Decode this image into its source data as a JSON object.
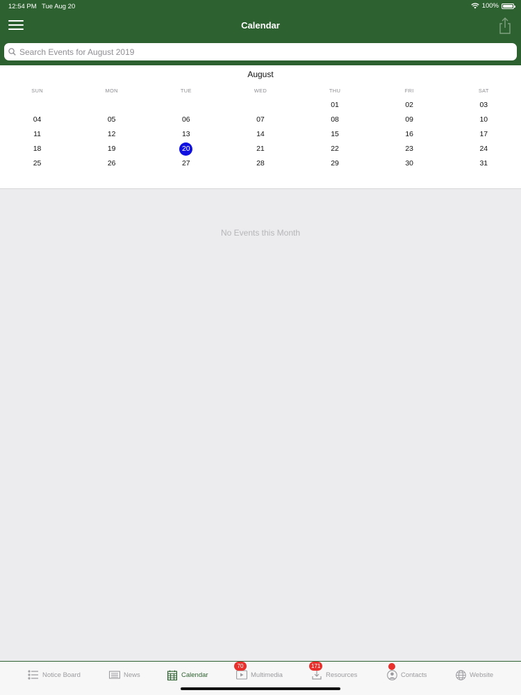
{
  "status": {
    "time": "12:54 PM",
    "date": "Tue Aug 20",
    "battery": "100%"
  },
  "nav": {
    "title": "Calendar"
  },
  "search": {
    "placeholder": "Search Events for August 2019"
  },
  "calendar": {
    "month": "August",
    "weekdays": [
      "SUN",
      "MON",
      "TUE",
      "WED",
      "THU",
      "FRI",
      "SAT"
    ],
    "weeks": [
      [
        "",
        "",
        "",
        "",
        "01",
        "02",
        "03"
      ],
      [
        "04",
        "05",
        "06",
        "07",
        "08",
        "09",
        "10"
      ],
      [
        "11",
        "12",
        "13",
        "14",
        "15",
        "16",
        "17"
      ],
      [
        "18",
        "19",
        "20",
        "21",
        "22",
        "23",
        "24"
      ],
      [
        "25",
        "26",
        "27",
        "28",
        "29",
        "30",
        "31"
      ]
    ],
    "selected_day": "20",
    "selected_color": "#1010e0"
  },
  "content": {
    "empty_message": "No Events this Month"
  },
  "tabs": [
    {
      "label": "Notice Board",
      "icon": "list-icon",
      "badge": ""
    },
    {
      "label": "News",
      "icon": "newspaper-icon",
      "badge": ""
    },
    {
      "label": "Calendar",
      "icon": "calendar-icon",
      "badge": "",
      "active": true
    },
    {
      "label": "Multimedia",
      "icon": "multimedia-icon",
      "badge": "70"
    },
    {
      "label": "Resources",
      "icon": "download-icon",
      "badge": "171"
    },
    {
      "label": "Contacts",
      "icon": "contacts-icon",
      "badge": ""
    },
    {
      "label": "Website",
      "icon": "globe-icon",
      "badge": ""
    }
  ],
  "colors": {
    "header": "#2e6130",
    "badge": "#e8312d"
  }
}
